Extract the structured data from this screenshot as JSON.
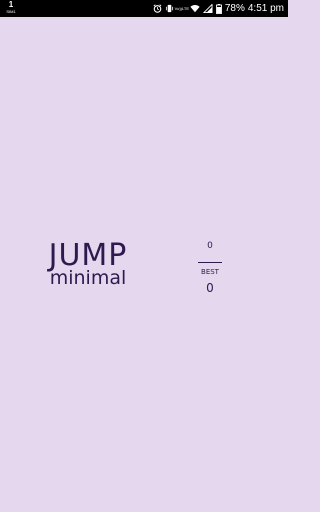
{
  "status_bar": {
    "sim_slot": "1",
    "sim_label": "SIM1",
    "volte_top": "Vo))",
    "volte_bottom": "LTE",
    "battery_percent": "78%",
    "time": "4:51 pm",
    "icons": [
      "alarm-clock-icon",
      "vibrate-icon",
      "wifi-icon",
      "signal-icon",
      "battery-icon"
    ]
  },
  "game": {
    "title": "JUMP",
    "subtitle": "minimal",
    "score": "0",
    "best_label": "BEST",
    "best_score": "0"
  },
  "colors": {
    "background": "#e5d8ee",
    "text": "#2e1a4e",
    "status_bar": "#000000"
  }
}
